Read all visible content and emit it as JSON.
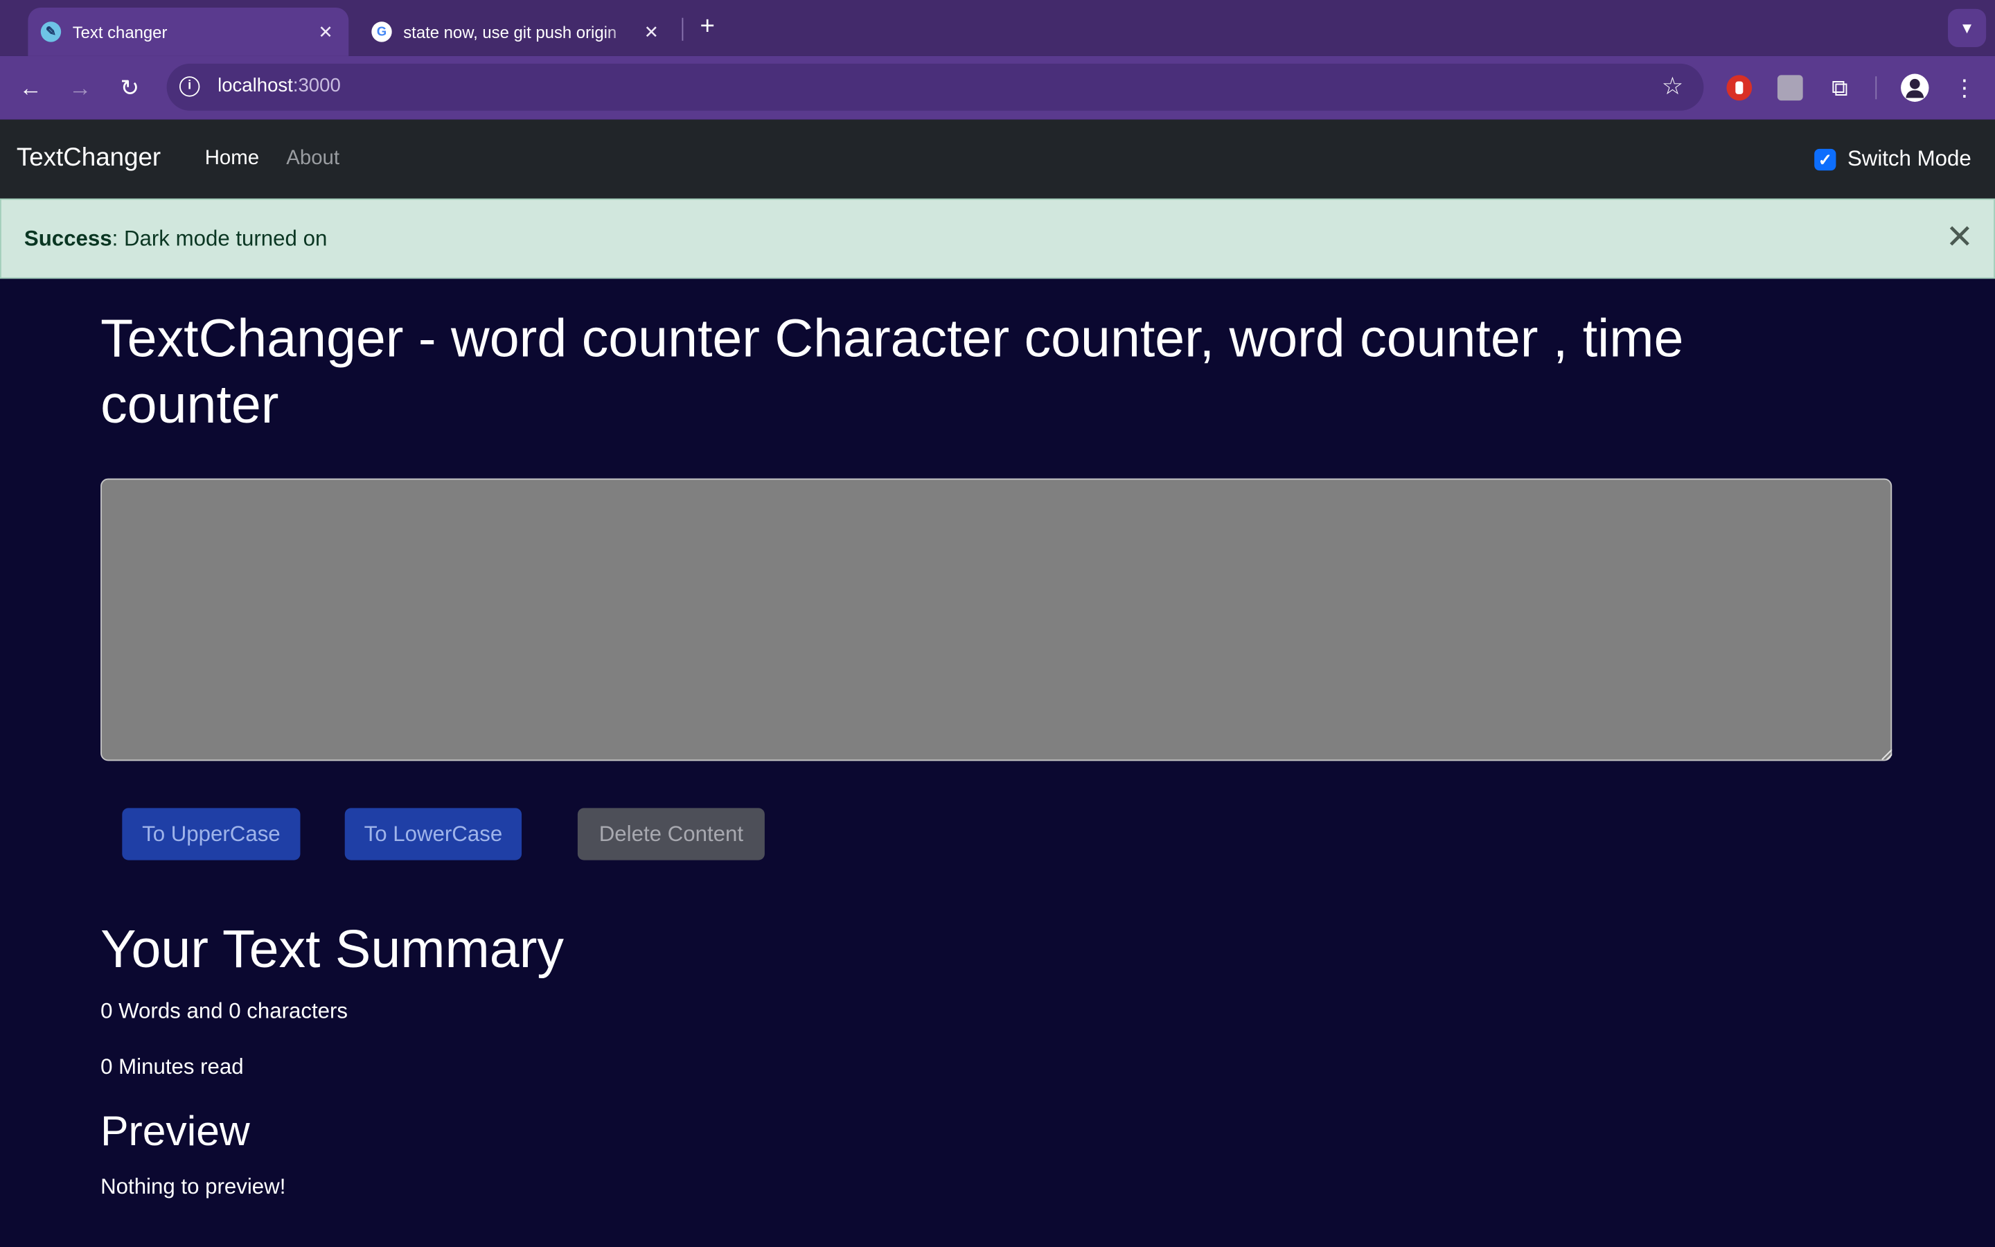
{
  "browser": {
    "tabs": [
      {
        "title": "Text changer",
        "favicon": "notepad-icon",
        "active": true
      },
      {
        "title": "state now, use git push origin",
        "favicon": "google-icon",
        "active": false
      }
    ],
    "url_host": "localhost",
    "url_port": ":3000"
  },
  "navbar": {
    "brand": "TextChanger",
    "links": [
      {
        "label": "Home"
      },
      {
        "label": "About"
      }
    ],
    "switch_label": "Switch Mode",
    "switch_checked": true
  },
  "alert": {
    "type": "Success",
    "message": ": Dark mode turned on"
  },
  "main": {
    "heading": "TextChanger - word counter Character counter, word counter , time counter",
    "textarea_value": "",
    "buttons": {
      "upper": "To UpperCase",
      "lower": "To LowerCase",
      "delete": "Delete Content"
    },
    "summary_title": "Your Text Summary",
    "words_line": "0 Words and 0 characters",
    "minutes_line": "0 Minutes read",
    "preview_title": "Preview",
    "preview_text": "Nothing to preview!"
  },
  "colors": {
    "background": "#0b0830",
    "navbar": "#212529",
    "alert_bg": "#d1e7dd",
    "primary_button": "#1f3fa6",
    "secondary_button": "#4d4f58",
    "textarea": "#808080",
    "browser_frame": "#5a3a8e"
  }
}
